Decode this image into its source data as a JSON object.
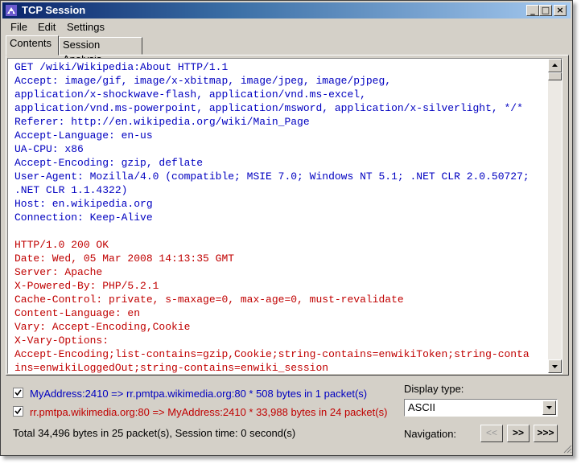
{
  "window": {
    "title": "TCP Session"
  },
  "menu": [
    "File",
    "Edit",
    "Settings"
  ],
  "tabs": [
    {
      "label": "Contents",
      "active": true
    },
    {
      "label": "Session Analysis",
      "active": false
    }
  ],
  "content": {
    "request_color": "#0000c0",
    "response_color": "#c00000",
    "request_lines": [
      "GET /wiki/Wikipedia:About HTTP/1.1",
      "Accept: image/gif, image/x-xbitmap, image/jpeg, image/pjpeg,",
      "application/x-shockwave-flash, application/vnd.ms-excel,",
      "application/vnd.ms-powerpoint, application/msword, application/x-silverlight, */*",
      "Referer: http://en.wikipedia.org/wiki/Main_Page",
      "Accept-Language: en-us",
      "UA-CPU: x86",
      "Accept-Encoding: gzip, deflate",
      "User-Agent: Mozilla/4.0 (compatible; MSIE 7.0; Windows NT 5.1; .NET CLR 2.0.50727;",
      ".NET CLR 1.1.4322)",
      "Host: en.wikipedia.org",
      "Connection: Keep-Alive"
    ],
    "response_lines": [
      "HTTP/1.0 200 OK",
      "Date: Wed, 05 Mar 2008 14:13:35 GMT",
      "Server: Apache",
      "X-Powered-By: PHP/5.2.1",
      "Cache-Control: private, s-maxage=0, max-age=0, must-revalidate",
      "Content-Language: en",
      "Vary: Accept-Encoding,Cookie",
      "X-Vary-Options:",
      "Accept-Encoding;list-contains=gzip,Cookie;string-contains=enwikiToken;string-conta",
      "ins=enwikiLoggedOut;string-contains=enwiki_session"
    ]
  },
  "sessions": [
    {
      "label": "MyAddress:2410 => rr.pmtpa.wikimedia.org:80 * 508 bytes in 1 packet(s)",
      "checked": true,
      "color": "#0000c0"
    },
    {
      "label": "rr.pmtpa.wikimedia.org:80 => MyAddress:2410 * 33,988 bytes in 24 packet(s)",
      "checked": true,
      "color": "#c00000"
    }
  ],
  "status": "Total 34,496 bytes in 25 packet(s), Session time: 0 second(s)",
  "display_type": {
    "label": "Display type:",
    "value": "ASCII"
  },
  "navigation": {
    "label": "Navigation:",
    "buttons": [
      {
        "label": "<<",
        "enabled": false
      },
      {
        "label": ">>",
        "enabled": true
      },
      {
        "label": ">>>",
        "enabled": true
      }
    ]
  }
}
